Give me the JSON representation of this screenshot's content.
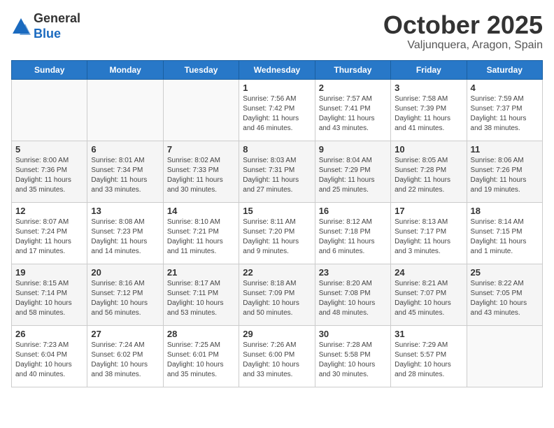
{
  "header": {
    "logo_line1": "General",
    "logo_line2": "Blue",
    "month": "October 2025",
    "location": "Valjunquera, Aragon, Spain"
  },
  "weekdays": [
    "Sunday",
    "Monday",
    "Tuesday",
    "Wednesday",
    "Thursday",
    "Friday",
    "Saturday"
  ],
  "weeks": [
    [
      {
        "day": "",
        "info": ""
      },
      {
        "day": "",
        "info": ""
      },
      {
        "day": "",
        "info": ""
      },
      {
        "day": "1",
        "info": "Sunrise: 7:56 AM\nSunset: 7:42 PM\nDaylight: 11 hours and 46 minutes."
      },
      {
        "day": "2",
        "info": "Sunrise: 7:57 AM\nSunset: 7:41 PM\nDaylight: 11 hours and 43 minutes."
      },
      {
        "day": "3",
        "info": "Sunrise: 7:58 AM\nSunset: 7:39 PM\nDaylight: 11 hours and 41 minutes."
      },
      {
        "day": "4",
        "info": "Sunrise: 7:59 AM\nSunset: 7:37 PM\nDaylight: 11 hours and 38 minutes."
      }
    ],
    [
      {
        "day": "5",
        "info": "Sunrise: 8:00 AM\nSunset: 7:36 PM\nDaylight: 11 hours and 35 minutes."
      },
      {
        "day": "6",
        "info": "Sunrise: 8:01 AM\nSunset: 7:34 PM\nDaylight: 11 hours and 33 minutes."
      },
      {
        "day": "7",
        "info": "Sunrise: 8:02 AM\nSunset: 7:33 PM\nDaylight: 11 hours and 30 minutes."
      },
      {
        "day": "8",
        "info": "Sunrise: 8:03 AM\nSunset: 7:31 PM\nDaylight: 11 hours and 27 minutes."
      },
      {
        "day": "9",
        "info": "Sunrise: 8:04 AM\nSunset: 7:29 PM\nDaylight: 11 hours and 25 minutes."
      },
      {
        "day": "10",
        "info": "Sunrise: 8:05 AM\nSunset: 7:28 PM\nDaylight: 11 hours and 22 minutes."
      },
      {
        "day": "11",
        "info": "Sunrise: 8:06 AM\nSunset: 7:26 PM\nDaylight: 11 hours and 19 minutes."
      }
    ],
    [
      {
        "day": "12",
        "info": "Sunrise: 8:07 AM\nSunset: 7:24 PM\nDaylight: 11 hours and 17 minutes."
      },
      {
        "day": "13",
        "info": "Sunrise: 8:08 AM\nSunset: 7:23 PM\nDaylight: 11 hours and 14 minutes."
      },
      {
        "day": "14",
        "info": "Sunrise: 8:10 AM\nSunset: 7:21 PM\nDaylight: 11 hours and 11 minutes."
      },
      {
        "day": "15",
        "info": "Sunrise: 8:11 AM\nSunset: 7:20 PM\nDaylight: 11 hours and 9 minutes."
      },
      {
        "day": "16",
        "info": "Sunrise: 8:12 AM\nSunset: 7:18 PM\nDaylight: 11 hours and 6 minutes."
      },
      {
        "day": "17",
        "info": "Sunrise: 8:13 AM\nSunset: 7:17 PM\nDaylight: 11 hours and 3 minutes."
      },
      {
        "day": "18",
        "info": "Sunrise: 8:14 AM\nSunset: 7:15 PM\nDaylight: 11 hours and 1 minute."
      }
    ],
    [
      {
        "day": "19",
        "info": "Sunrise: 8:15 AM\nSunset: 7:14 PM\nDaylight: 10 hours and 58 minutes."
      },
      {
        "day": "20",
        "info": "Sunrise: 8:16 AM\nSunset: 7:12 PM\nDaylight: 10 hours and 56 minutes."
      },
      {
        "day": "21",
        "info": "Sunrise: 8:17 AM\nSunset: 7:11 PM\nDaylight: 10 hours and 53 minutes."
      },
      {
        "day": "22",
        "info": "Sunrise: 8:18 AM\nSunset: 7:09 PM\nDaylight: 10 hours and 50 minutes."
      },
      {
        "day": "23",
        "info": "Sunrise: 8:20 AM\nSunset: 7:08 PM\nDaylight: 10 hours and 48 minutes."
      },
      {
        "day": "24",
        "info": "Sunrise: 8:21 AM\nSunset: 7:07 PM\nDaylight: 10 hours and 45 minutes."
      },
      {
        "day": "25",
        "info": "Sunrise: 8:22 AM\nSunset: 7:05 PM\nDaylight: 10 hours and 43 minutes."
      }
    ],
    [
      {
        "day": "26",
        "info": "Sunrise: 7:23 AM\nSunset: 6:04 PM\nDaylight: 10 hours and 40 minutes."
      },
      {
        "day": "27",
        "info": "Sunrise: 7:24 AM\nSunset: 6:02 PM\nDaylight: 10 hours and 38 minutes."
      },
      {
        "day": "28",
        "info": "Sunrise: 7:25 AM\nSunset: 6:01 PM\nDaylight: 10 hours and 35 minutes."
      },
      {
        "day": "29",
        "info": "Sunrise: 7:26 AM\nSunset: 6:00 PM\nDaylight: 10 hours and 33 minutes."
      },
      {
        "day": "30",
        "info": "Sunrise: 7:28 AM\nSunset: 5:58 PM\nDaylight: 10 hours and 30 minutes."
      },
      {
        "day": "31",
        "info": "Sunrise: 7:29 AM\nSunset: 5:57 PM\nDaylight: 10 hours and 28 minutes."
      },
      {
        "day": "",
        "info": ""
      }
    ]
  ]
}
